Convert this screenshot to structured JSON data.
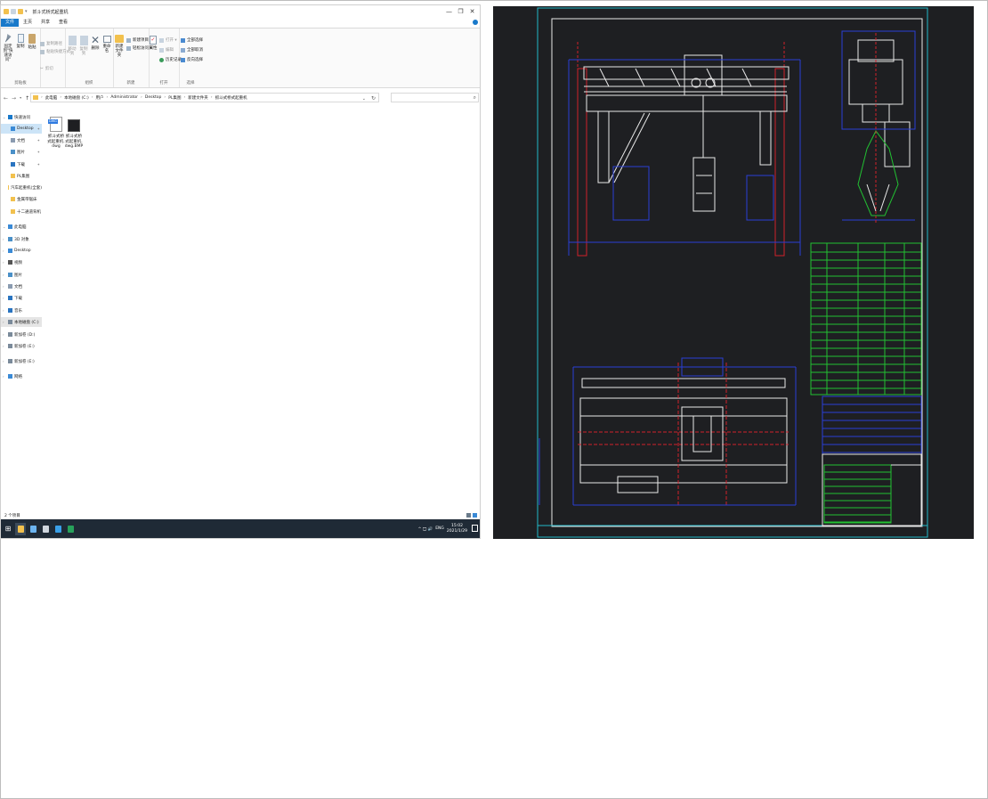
{
  "window": {
    "title": "抓斗式桥式起重机",
    "controls": {
      "minimize": "—",
      "maximize": "❐",
      "close": "✕"
    }
  },
  "ribbon_tabs": [
    "文件",
    "主页",
    "共享",
    "查看"
  ],
  "ribbon": {
    "clipboard": {
      "pin_label": "固定到\"快速访问\"",
      "copy_label": "复制",
      "paste_label": "粘贴",
      "copy_path": "复制路径",
      "paste_shortcut": "粘贴快捷方式",
      "cut": "剪切",
      "group": "剪贴板"
    },
    "organize": {
      "move_to": "移动到",
      "copy_to": "复制到",
      "delete": "删除",
      "rename": "重命名",
      "group": "组织"
    },
    "new": {
      "new_folder": "新建\n文件夹",
      "new_item": "新建项目 ▾",
      "easy_access": "轻松访问 ▾",
      "group": "新建"
    },
    "open": {
      "properties": "属性",
      "open": "打开 ▾",
      "edit": "编辑",
      "history": "历史记录",
      "group": "打开"
    },
    "select": {
      "select_all": "全部选择",
      "select_none": "全部取消",
      "invert": "反向选择",
      "group": "选择"
    }
  },
  "address": {
    "crumbs": [
      "此电脑",
      "本地磁盘 (C:)",
      "用户",
      "Administrator",
      "Desktop",
      "PL集图",
      "新建文件夹",
      "抓斗式桥式起重机"
    ]
  },
  "nav_pane": [
    {
      "label": "快速访问",
      "icon": "star-icon",
      "color": "#1979ca",
      "level": 0,
      "chev": "v"
    },
    {
      "label": "Desktop",
      "icon": "desktop-icon",
      "color": "#3a8ad6",
      "level": 1,
      "selected": true,
      "pinned": true
    },
    {
      "label": "文档",
      "icon": "document-icon",
      "color": "#8a9bb0",
      "level": 1,
      "pinned": true
    },
    {
      "label": "图片",
      "icon": "picture-icon",
      "color": "#4a90c8",
      "level": 1,
      "pinned": true
    },
    {
      "label": "下载",
      "icon": "download-icon",
      "color": "#2a74c0",
      "level": 1,
      "pinned": true
    },
    {
      "label": "PL集图",
      "icon": "folder-icon",
      "color": "#f2c14e",
      "level": 1
    },
    {
      "label": "汽车起重机(全套)",
      "icon": "folder-icon",
      "color": "#f2c14e",
      "level": 1
    },
    {
      "label": "金属带锯床",
      "icon": "folder-icon",
      "color": "#f2c14e",
      "level": 1
    },
    {
      "label": "十二通道背机",
      "icon": "folder-icon",
      "color": "#f2c14e",
      "level": 1
    },
    {
      "label": "此电脑",
      "icon": "computer-icon",
      "color": "#3a8ad6",
      "level": 0,
      "chev": "v"
    },
    {
      "label": "3D 对象",
      "icon": "cube-icon",
      "color": "#4a90c8",
      "level": 1,
      "chev": ">"
    },
    {
      "label": "Desktop",
      "icon": "desktop-icon",
      "color": "#3a8ad6",
      "level": 1,
      "chev": ">"
    },
    {
      "label": "视频",
      "icon": "video-icon",
      "color": "#555",
      "level": 1,
      "chev": ">"
    },
    {
      "label": "图片",
      "icon": "picture-icon",
      "color": "#4a90c8",
      "level": 1,
      "chev": ">"
    },
    {
      "label": "文档",
      "icon": "document-icon",
      "color": "#8a9bb0",
      "level": 1,
      "chev": ">"
    },
    {
      "label": "下载",
      "icon": "download-icon",
      "color": "#2a74c0",
      "level": 1,
      "chev": ">"
    },
    {
      "label": "音乐",
      "icon": "music-icon",
      "color": "#2a74c0",
      "level": 1,
      "chev": ">"
    },
    {
      "label": "本地磁盘 (C:)",
      "icon": "drive-icon",
      "color": "#7a8a9a",
      "level": 1,
      "chev": ">",
      "highlight": true
    },
    {
      "label": "新加卷 (D:)",
      "icon": "drive-icon",
      "color": "#7a8a9a",
      "level": 1,
      "chev": ">"
    },
    {
      "label": "新加卷 (E:)",
      "icon": "drive-icon",
      "color": "#7a8a9a",
      "level": 1,
      "chev": ">"
    },
    {
      "label": "新加卷 (E:)",
      "icon": "drive-icon",
      "color": "#7a8a9a",
      "level": 0,
      "chev": ">"
    },
    {
      "label": "网络",
      "icon": "network-icon",
      "color": "#3a8ad6",
      "level": 0,
      "chev": ">"
    }
  ],
  "files": [
    {
      "name": "抓斗式桥式起重机.dwg",
      "icon": "dwg-file-icon",
      "badge": "DWG"
    },
    {
      "name": "抓斗式桥式起重机.dwg.BMP",
      "icon": "bmp-file-icon"
    }
  ],
  "status": {
    "count": "2 个项目"
  },
  "taskbar": {
    "apps": [
      {
        "icon": "file-explorer-icon",
        "color": "#f2c14e",
        "active": true
      },
      {
        "icon": "browser-icon",
        "color": "#6cb4f0"
      },
      {
        "icon": "app-icon",
        "color": "#cfd6de"
      },
      {
        "icon": "cad-app-icon",
        "color": "#3aa0e8"
      },
      {
        "icon": "spreadsheet-icon",
        "color": "#27a15b"
      }
    ],
    "tray": {
      "icons": "^ 🖵 🔊 ",
      "lang": "ENG",
      "time": "15:02",
      "date": "2021/1/29"
    }
  },
  "cad": {
    "colors": {
      "frame": "#23b9c8",
      "white": "#e8e8e8",
      "red": "#d0202a",
      "blue": "#2a3fd6",
      "green": "#22c032",
      "bg": "#1e1f22"
    }
  }
}
